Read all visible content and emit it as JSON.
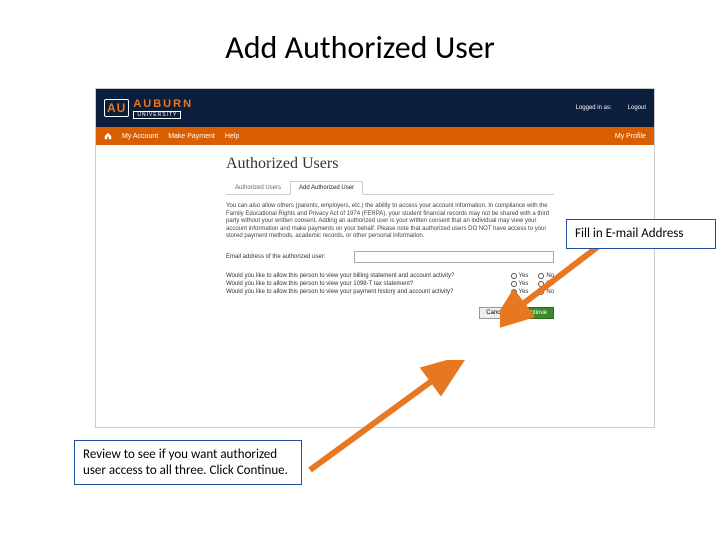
{
  "slide": {
    "title": "Add Authorized User"
  },
  "header": {
    "brand_mark": "AU",
    "brand_text": "AUBURN",
    "brand_sub": "UNIVERSITY",
    "logged_in_label": "Logged in as:",
    "logout_label": "Logout"
  },
  "nav": {
    "my_account": "My Account",
    "make_payment": "Make Payment",
    "help": "Help",
    "my_profile": "My Profile"
  },
  "page": {
    "heading": "Authorized Users",
    "tabs": {
      "list": "Authorized Users",
      "add": "Add Authorized User"
    },
    "description": "You can also allow others (parents, employers, etc.) the ability to access your account information. In compliance with the Family Educational Rights and Privacy Act of 1974 (FERPA), your student financial records may not be shared with a third party without your written consent. Adding an authorized user is your written consent that an individual may view your account information and make payments on your behalf. Please note that authorized users DO NOT have access to your stored payment methods, academic records, or other personal information.",
    "email_label": "Email address of the authorized user:",
    "questions": {
      "q1": "Would you like to allow this person to view your billing statement and account activity?",
      "q2": "Would you like to allow this person to view your 1098-T tax statement?",
      "q3": "Would you like to allow this person to view your payment history and account activity?"
    },
    "opts": {
      "yes": "Yes",
      "no": "No"
    },
    "buttons": {
      "cancel": "Cancel",
      "continue": "Continue"
    }
  },
  "callouts": {
    "email": "Fill in E-mail Address",
    "review": "Review to see if you want authorized user access to all three. Click Continue."
  }
}
